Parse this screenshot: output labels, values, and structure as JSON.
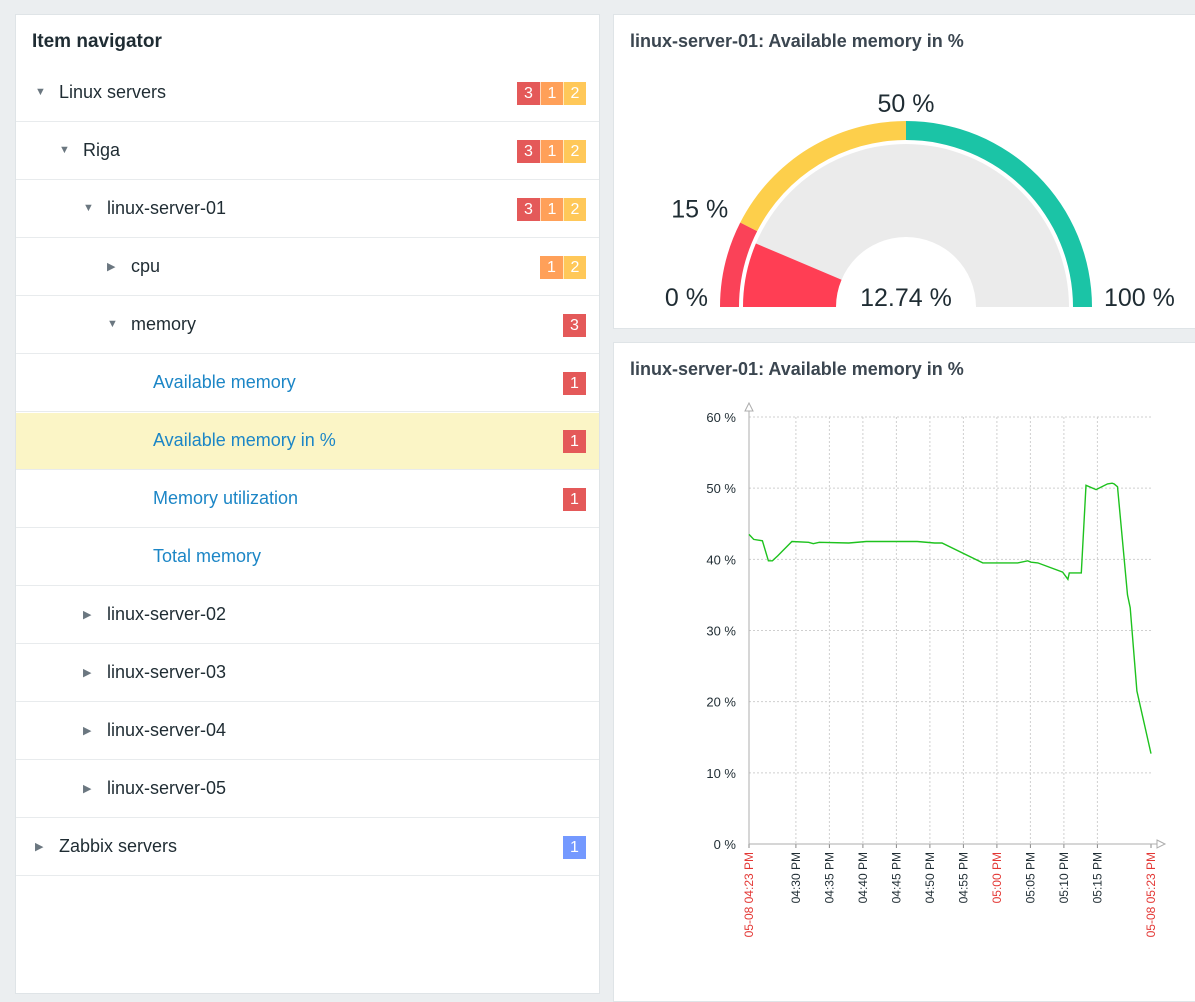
{
  "navigator": {
    "title": "Item navigator",
    "rows": [
      {
        "label": "Linux servers",
        "arrow": "▼",
        "level": 0,
        "link": false,
        "selected": false,
        "badges": [
          {
            "text": "3",
            "color": "#e45959"
          },
          {
            "text": "1",
            "color": "#ffa059"
          },
          {
            "text": "2",
            "color": "#ffc859"
          }
        ]
      },
      {
        "label": "Riga",
        "arrow": "▼",
        "level": 1,
        "link": false,
        "selected": false,
        "badges": [
          {
            "text": "3",
            "color": "#e45959"
          },
          {
            "text": "1",
            "color": "#ffa059"
          },
          {
            "text": "2",
            "color": "#ffc859"
          }
        ]
      },
      {
        "label": "linux-server-01",
        "arrow": "▼",
        "level": 2,
        "link": false,
        "selected": false,
        "badges": [
          {
            "text": "3",
            "color": "#e45959"
          },
          {
            "text": "1",
            "color": "#ffa059"
          },
          {
            "text": "2",
            "color": "#ffc859"
          }
        ]
      },
      {
        "label": "cpu",
        "arrow": "▶",
        "level": 3,
        "link": false,
        "selected": false,
        "badges": [
          {
            "text": "1",
            "color": "#ffa059"
          },
          {
            "text": "2",
            "color": "#ffc859"
          }
        ]
      },
      {
        "label": "memory",
        "arrow": "▼",
        "level": 3,
        "link": false,
        "selected": false,
        "badges": [
          {
            "text": "3",
            "color": "#e45959"
          }
        ]
      },
      {
        "label": "Available memory",
        "arrow": "",
        "level": 4,
        "link": true,
        "selected": false,
        "badges": [
          {
            "text": "1",
            "color": "#e45959"
          }
        ]
      },
      {
        "label": "Available memory in %",
        "arrow": "",
        "level": 4,
        "link": true,
        "selected": true,
        "badges": [
          {
            "text": "1",
            "color": "#e45959"
          }
        ]
      },
      {
        "label": "Memory utilization",
        "arrow": "",
        "level": 4,
        "link": true,
        "selected": false,
        "badges": [
          {
            "text": "1",
            "color": "#e45959"
          }
        ]
      },
      {
        "label": "Total memory",
        "arrow": "",
        "level": 4,
        "link": true,
        "selected": false,
        "badges": []
      },
      {
        "label": "linux-server-02",
        "arrow": "▶",
        "level": 2,
        "link": false,
        "selected": false,
        "badges": []
      },
      {
        "label": "linux-server-03",
        "arrow": "▶",
        "level": 2,
        "link": false,
        "selected": false,
        "badges": []
      },
      {
        "label": "linux-server-04",
        "arrow": "▶",
        "level": 2,
        "link": false,
        "selected": false,
        "badges": []
      },
      {
        "label": "linux-server-05",
        "arrow": "▶",
        "level": 2,
        "link": false,
        "selected": false,
        "badges": []
      },
      {
        "label": "Zabbix servers",
        "arrow": "▶",
        "level": 0,
        "link": false,
        "selected": false,
        "badges": [
          {
            "text": "1",
            "color": "#7499ff"
          }
        ]
      }
    ]
  },
  "gauge": {
    "title": "linux-server-01: Available memory in %",
    "value": 12.74,
    "value_label": "12.74 %",
    "min": 0,
    "max": 100,
    "min_label": "0 %",
    "max_label": "100 %",
    "thresholds": [
      {
        "value": 15,
        "label": "15 %"
      },
      {
        "value": 50,
        "label": "50 %"
      }
    ],
    "colors": {
      "red": "#fa4258",
      "yellow": "#fdcf4b",
      "green": "#1bc4a6",
      "track": "#ebebeb",
      "needle": "#ff3e54"
    }
  },
  "graph": {
    "title": "linux-server-01: Available memory in %"
  },
  "chart_data": {
    "type": "line",
    "ylim": [
      0,
      60
    ],
    "yticks": [
      "0 %",
      "10 %",
      "20 %",
      "30 %",
      "40 %",
      "50 %",
      "60 %"
    ],
    "xrange_min": [
      0,
      60
    ],
    "xticks": [
      {
        "min": 0,
        "label": "05-08 04:23 PM",
        "red": true
      },
      {
        "min": 7,
        "label": "04:30 PM",
        "red": false
      },
      {
        "min": 12,
        "label": "04:35 PM",
        "red": false
      },
      {
        "min": 17,
        "label": "04:40 PM",
        "red": false
      },
      {
        "min": 22,
        "label": "04:45 PM",
        "red": false
      },
      {
        "min": 27,
        "label": "04:50 PM",
        "red": false
      },
      {
        "min": 32,
        "label": "04:55 PM",
        "red": false
      },
      {
        "min": 37,
        "label": "05:00 PM",
        "red": true
      },
      {
        "min": 42,
        "label": "05:05 PM",
        "red": false
      },
      {
        "min": 47,
        "label": "05:10 PM",
        "red": false
      },
      {
        "min": 52,
        "label": "05:15 PM",
        "red": false
      },
      {
        "min": 60,
        "label": "05-08 05:23 PM",
        "red": true
      }
    ],
    "series": [
      {
        "color": "#1ec21e",
        "x": [
          0,
          0.7,
          2,
          2.9,
          3.5,
          4.3,
          6.4,
          8.9,
          9.6,
          10.5,
          14.9,
          17.5,
          25.1,
          27.7,
          28.8,
          34.9,
          35.8,
          37.6,
          40.1,
          41.6,
          42.1,
          43.1,
          46.8,
          47.6,
          47.8,
          48.6,
          49.6,
          50.3,
          51.8,
          53.5,
          54.2,
          54.5,
          55.0,
          56.5,
          56.9,
          57.9,
          60
        ],
        "y": [
          43.5,
          42.8,
          42.6,
          39.8,
          39.8,
          40.5,
          42.5,
          42.4,
          42.2,
          42.4,
          42.3,
          42.5,
          42.5,
          42.3,
          42.3,
          39.5,
          39.5,
          39.5,
          39.5,
          39.8,
          39.6,
          39.5,
          38.2,
          37.2,
          38.1,
          38.1,
          38.1,
          50.4,
          49.8,
          50.6,
          50.7,
          50.6,
          50.2,
          35.0,
          33.2,
          21.5,
          12.7
        ]
      }
    ]
  }
}
